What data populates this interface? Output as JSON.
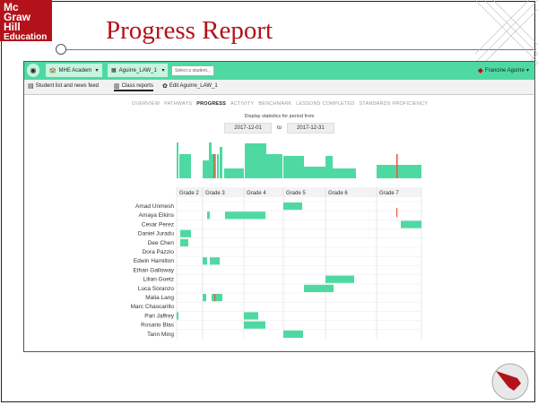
{
  "slide": {
    "title": "Progress Report",
    "logo": [
      "Mc",
      "Graw",
      "Hill",
      "Education"
    ]
  },
  "app": {
    "school_label": "MHE Academy",
    "class_label": "Aguirre_LAW_1",
    "student_placeholder": "Select a student...",
    "user_name": "Francine Aguirre",
    "subnav": [
      {
        "label": "Student list and news feed",
        "icon": "newspaper-icon"
      },
      {
        "label": "Class reports",
        "icon": "bar-chart-icon"
      },
      {
        "label": "Edit Aguirre_LAW_1",
        "icon": "gear-icon"
      }
    ],
    "tabs": [
      "OVERVIEW",
      "PATHWAYS",
      "PROGRESS",
      "ACTIVITY",
      "BENCHMARK",
      "LESSONS COMPLETED",
      "STANDARDS PROFICIENCY"
    ],
    "active_tab": "PROGRESS",
    "period_label": "Display statistics for period from",
    "date_from": "2017-12-01",
    "date_to_label": "to",
    "date_to": "2017-12-31",
    "grades": [
      "Grade 2",
      "Grade 3",
      "Grade 4",
      "Grade 5",
      "Grade 6",
      "Grade 7"
    ],
    "students": [
      "Amad Unmesh",
      "Amaya Elkins",
      "Cesar Perez",
      "Daniel Juradu",
      "Dee Chen",
      "Dora Pazzio",
      "Edwin Hamilton",
      "Ethan Galloway",
      "Lilian Goetz",
      "Luca Soranzo",
      "Malia Lang",
      "Marc Chascarillo",
      "Pari Jaffrey",
      "Rosario Blas",
      "Tann Ming"
    ],
    "colors": {
      "bar": "#4fd9a2",
      "marker": "#e25a3c",
      "topbar": "#4fd9a2"
    }
  }
}
